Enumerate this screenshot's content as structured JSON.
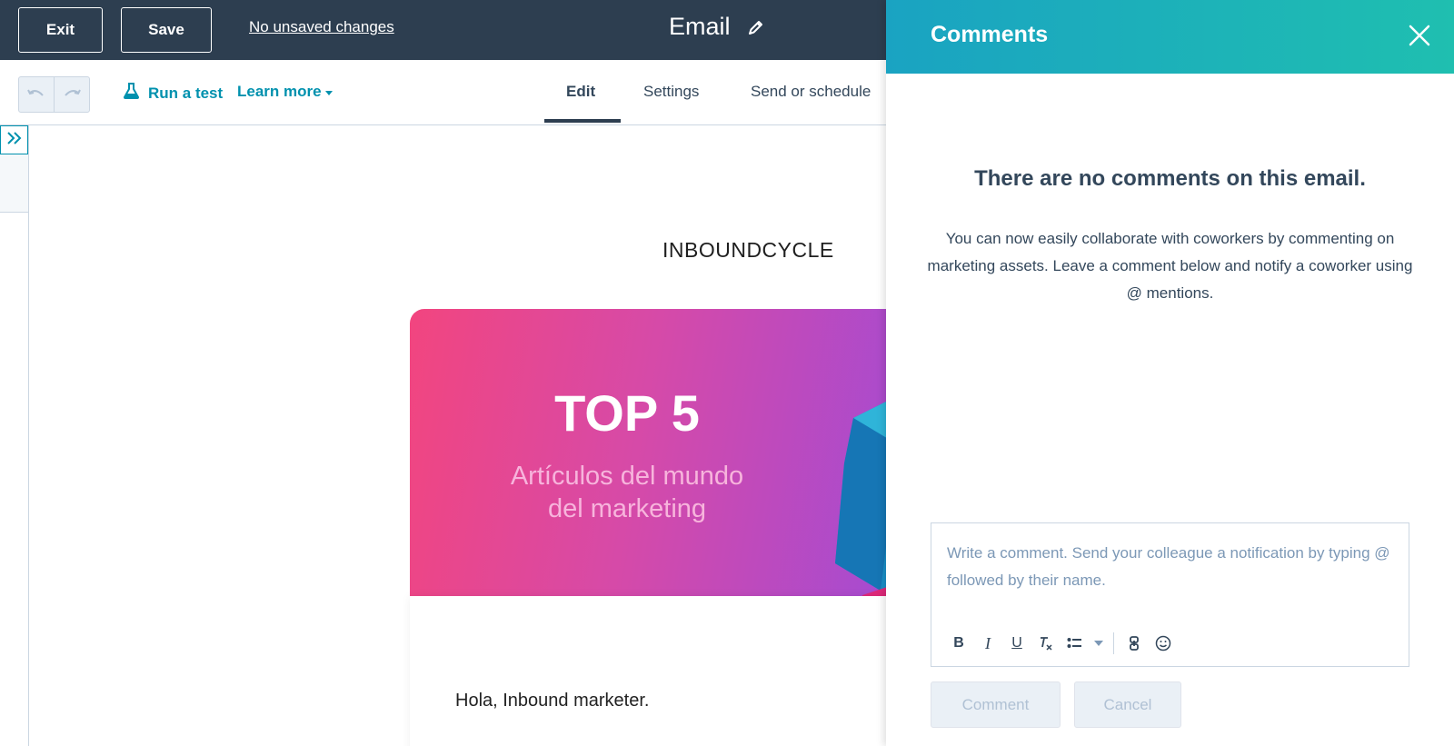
{
  "topbar": {
    "exit_label": "Exit",
    "save_label": "Save",
    "status": "No unsaved changes",
    "title": "Email"
  },
  "toolbar": {
    "run_test": "Run a test",
    "learn_more": "Learn more",
    "tabs": [
      {
        "label": "Edit",
        "active": true
      },
      {
        "label": "Settings",
        "active": false
      },
      {
        "label": "Send or schedule",
        "active": false
      }
    ]
  },
  "email": {
    "logo_text": "INBOUNDCYCLE",
    "banner_title": "TOP 5",
    "banner_subtitle_line1": "Artículos del mundo",
    "banner_subtitle_line2": "del marketing",
    "greeting": "Hola, Inbound marketer."
  },
  "comments": {
    "title": "Comments",
    "empty_title": "There are no comments on this email.",
    "empty_text": "You can now easily collaborate with coworkers by commenting on marketing assets. Leave a comment below and notify a coworker using @ mentions.",
    "input_value": "",
    "input_placeholder": "Write a comment. Send your colleague a notification by typing @ followed by their name.",
    "comment_label": "Comment",
    "cancel_label": "Cancel"
  },
  "icons": {
    "pencil": "pencil-icon",
    "undo": "undo-icon",
    "redo": "redo-icon",
    "flask": "flask-icon",
    "expand": "double-chevron-right-icon",
    "close": "close-icon",
    "bold": "bold-icon",
    "italic": "italic-icon",
    "underline": "underline-icon",
    "clear_format": "clear-format-icon",
    "list": "list-icon",
    "link": "link-icon",
    "emoji": "emoji-icon"
  },
  "colors": {
    "topbar_bg": "#2d3e50",
    "accent_teal": "#0091ae",
    "panel_header_start": "#1aa3c2",
    "panel_header_end": "#1fbfb0",
    "banner_start": "#f2457f",
    "banner_end": "#a04bd6"
  }
}
